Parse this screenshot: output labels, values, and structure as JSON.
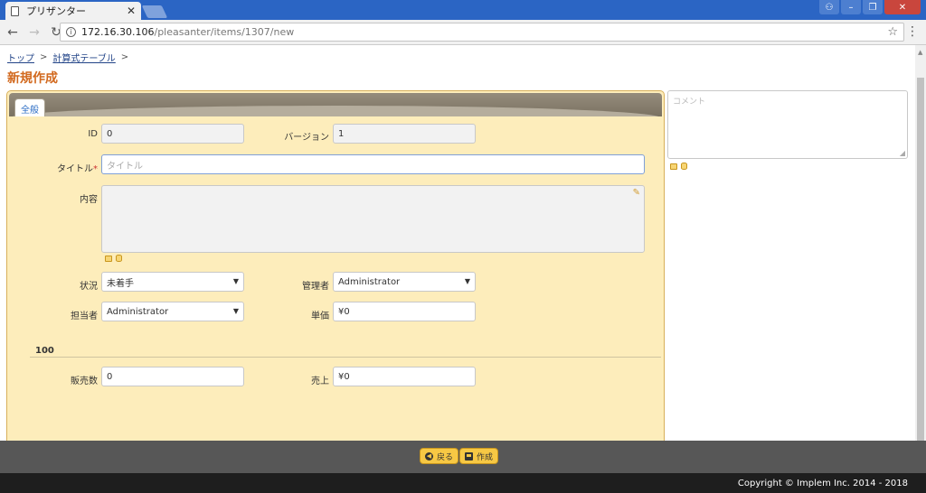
{
  "browser": {
    "tab_title": "プリザンター",
    "tab_close": "✕",
    "url_host": "172.16.30.106",
    "url_path": "/pleasanter/items/1307/new"
  },
  "breadcrumb": {
    "items": [
      "トップ",
      "計算式テーブル"
    ],
    "separator": ">"
  },
  "page_title": "新規作成",
  "tabs": [
    {
      "label": "全般"
    }
  ],
  "fields": {
    "id": {
      "label": "ID",
      "value": "0"
    },
    "version": {
      "label": "バージョン",
      "value": "1"
    },
    "title": {
      "label": "タイトル",
      "required_mark": "*",
      "placeholder": "タイトル"
    },
    "body": {
      "label": "内容"
    },
    "status": {
      "label": "状況",
      "value": "未着手"
    },
    "manager": {
      "label": "管理者",
      "value": "Administrator"
    },
    "owner": {
      "label": "担当者",
      "value": "Administrator"
    },
    "unit_price": {
      "label": "単価",
      "value": "¥0"
    },
    "section_title": "100",
    "quantity": {
      "label": "販売数",
      "value": "0"
    },
    "sales": {
      "label": "売上",
      "value": "¥0"
    }
  },
  "comment": {
    "placeholder": "コメント"
  },
  "actions": {
    "back_label": "戻る",
    "create_label": "作成"
  },
  "copyright": "Copyright © Implem Inc. 2014 - 2018"
}
